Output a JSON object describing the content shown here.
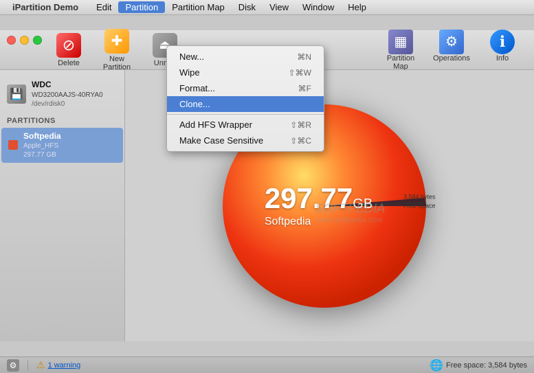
{
  "app": {
    "title": "iPartition Demo",
    "apple_symbol": ""
  },
  "menubar": {
    "items": [
      {
        "id": "apple",
        "label": ""
      },
      {
        "id": "ipartition",
        "label": "iPartition Demo"
      },
      {
        "id": "edit",
        "label": "Edit"
      },
      {
        "id": "partition",
        "label": "Partition",
        "active": true
      },
      {
        "id": "partition_map",
        "label": "Partition Map"
      },
      {
        "id": "disk",
        "label": "Disk"
      },
      {
        "id": "view",
        "label": "View"
      },
      {
        "id": "window",
        "label": "Window"
      },
      {
        "id": "help",
        "label": "Help"
      }
    ]
  },
  "toolbar": {
    "buttons": [
      {
        "id": "delete",
        "label": "Delete"
      },
      {
        "id": "new_partition",
        "label": "New Partition"
      },
      {
        "id": "unmount",
        "label": "Unm..."
      }
    ],
    "right_buttons": [
      {
        "id": "partition_map",
        "label": "Partition Map"
      },
      {
        "id": "operations",
        "label": "Operations"
      },
      {
        "id": "info",
        "label": "Info"
      }
    ]
  },
  "sidebar": {
    "disk": {
      "name": "WDC",
      "model": "WD3200AAJS-40RYA0",
      "device": "/dev/rdisk0"
    },
    "partitions_header": "Partitions",
    "partitions": [
      {
        "name": "Softpedia",
        "filesystem": "Apple_HFS",
        "size": "297.77 GB",
        "color": "#e05030"
      }
    ]
  },
  "pie_chart": {
    "size": "297.77",
    "unit": "GB",
    "label": "Softpedia",
    "free_space_label": "3,584",
    "free_space_unit": "bytes",
    "free_space_caption": "Free Space"
  },
  "watermark": {
    "text": "SOFTPEDIA",
    "url": "www.softpedia.com"
  },
  "dropdown_menu": {
    "items": [
      {
        "id": "new",
        "label": "New...",
        "shortcut": "⌘N",
        "disabled": false,
        "highlighted": false
      },
      {
        "id": "wipe",
        "label": "Wipe",
        "shortcut": "⇧⌘W",
        "disabled": false,
        "highlighted": false
      },
      {
        "id": "format",
        "label": "Format...",
        "shortcut": "⌘F",
        "disabled": false,
        "highlighted": false
      },
      {
        "id": "clone",
        "label": "Clone...",
        "shortcut": "",
        "disabled": false,
        "highlighted": true
      },
      {
        "id": "divider1",
        "label": "",
        "shortcut": "",
        "divider": true
      },
      {
        "id": "add_hfs",
        "label": "Add HFS Wrapper",
        "shortcut": "⇧⌘R",
        "disabled": false,
        "highlighted": false
      },
      {
        "id": "make_case",
        "label": "Make Case Sensitive",
        "shortcut": "⇧⌘C",
        "disabled": false,
        "highlighted": false
      }
    ]
  },
  "status_bar": {
    "warning_text": "1 warning",
    "free_space": "Free space: 3,584 bytes"
  }
}
